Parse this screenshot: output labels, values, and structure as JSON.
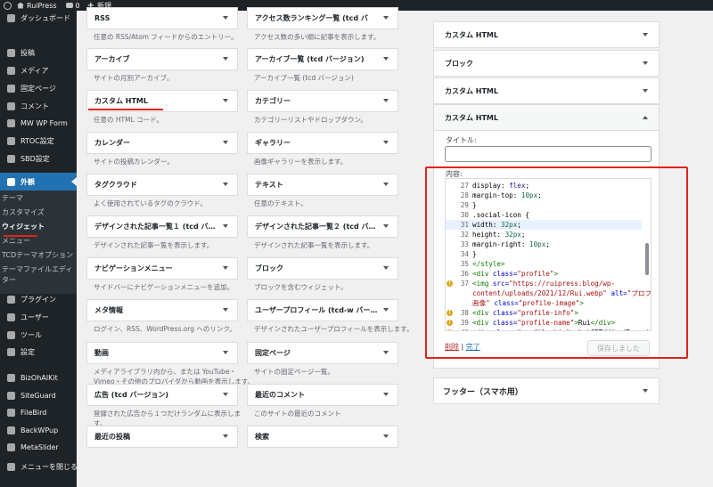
{
  "admin_bar": {
    "site_name": "RuiPress",
    "comments_count": "0",
    "new_label": "新規"
  },
  "sidebar": {
    "items": [
      {
        "label": "ダッシュボード",
        "icon": "dashboard-icon"
      },
      {
        "label": "投稿",
        "icon": "pin-icon"
      },
      {
        "label": "メディア",
        "icon": "media-icon"
      },
      {
        "label": "固定ページ",
        "icon": "page-icon"
      },
      {
        "label": "コメント",
        "icon": "comment-icon"
      },
      {
        "label": "MW WP Form",
        "icon": "form-icon"
      },
      {
        "label": "RTOC設定",
        "icon": "list-icon"
      },
      {
        "label": "SBD設定",
        "icon": "gear-icon"
      },
      {
        "label": "外観",
        "icon": "brush-icon"
      },
      {
        "label": "プラグイン",
        "icon": "plugin-icon"
      },
      {
        "label": "ユーザー",
        "icon": "user-icon"
      },
      {
        "label": "ツール",
        "icon": "wrench-icon"
      },
      {
        "label": "設定",
        "icon": "settings-icon"
      },
      {
        "label": "BizOhAIKit",
        "icon": "kit-icon"
      },
      {
        "label": "SiteGuard",
        "icon": "shield-icon"
      },
      {
        "label": "FileBird",
        "icon": "folder-icon"
      },
      {
        "label": "BackWPup",
        "icon": "backup-icon"
      },
      {
        "label": "MetaSlider",
        "icon": "slider-icon"
      },
      {
        "label": "メニューを閉じる",
        "icon": "collapse-icon"
      }
    ],
    "submenu": [
      "テーマ",
      "カスタマイズ",
      "ウィジェット",
      "メニュー",
      "TCDテーマオプション",
      "テーマファイルエディ",
      "ター"
    ]
  },
  "widgets": [
    {
      "title": "RSS",
      "desc": "任意の RSS/Atom フィードからのエントリー。"
    },
    {
      "title": "アクセス数ランキング一覧 (tcd バ",
      "desc": "アクセス数の多い順に記事を表示します。"
    },
    {
      "title": "アーカイブ",
      "desc": "サイトの月別アーカイブ。"
    },
    {
      "title": "アーカイブ一覧 (tcd バージョン)",
      "desc": "アーカイブ一覧 (tcd バージョン)"
    },
    {
      "title": "カスタム HTML",
      "desc": "任意の HTML コード。"
    },
    {
      "title": "カテゴリー",
      "desc": "カテゴリーリストやドロップダウン。"
    },
    {
      "title": "カレンダー",
      "desc": "サイトの投稿カレンダー。"
    },
    {
      "title": "ギャラリー",
      "desc": "画像ギャラリーを表示します。"
    },
    {
      "title": "タグクラウド",
      "desc": "よく使用されているタグのクラウド。"
    },
    {
      "title": "テキスト",
      "desc": "任意のテキスト。"
    },
    {
      "title": "デザインされた記事一覧１ (tcd バ…",
      "desc": "デザインされた記事一覧を表示します。"
    },
    {
      "title": "デザインされた記事一覧２ (tcd バ…",
      "desc": "デザインされた記事一覧を表示します。"
    },
    {
      "title": "ナビゲーションメニュー",
      "desc": "サイドバーにナビゲーションメニューを追加。"
    },
    {
      "title": "ブロック",
      "desc": "ブロックを含むウィジェット。"
    },
    {
      "title": "メタ情報",
      "desc": "ログイン、RSS、WordPress.org へのリンク。"
    },
    {
      "title": "ユーザープロフィール (tcd-w バー…",
      "desc": "デザインされたユーザープロフィールを表示します。"
    },
    {
      "title": "動画",
      "desc": "メディアライブラリ内から、または YouTube・",
      "desc2": "Vimeo・その他のプロバイダから動画を表示します。"
    },
    {
      "title": "固定ページ",
      "desc": "サイトの固定ページ一覧。"
    },
    {
      "title": "広告 (tcd バージョン)",
      "desc": "登録された広告から１つだけランダムに表示しま",
      "desc2": "す。"
    },
    {
      "title": "最近のコメント",
      "desc": "このサイトの最近のコメント"
    },
    {
      "title": "最近の投稿",
      "desc": ""
    },
    {
      "title": "検索",
      "desc": ""
    }
  ],
  "widget_area": {
    "items": [
      "カスタム HTML",
      "ブロック",
      "カスタム HTML",
      "カスタム HTML"
    ],
    "title_label": "タイトル:",
    "content_label": "内容:",
    "delete_link": "削除",
    "separator": " | ",
    "done_link": "完了",
    "save_button": "保存しました",
    "footer_area": "フッター（スマホ用）"
  },
  "code_lines": [
    {
      "n": "27",
      "parts": [
        [
          "",
          "    display: "
        ],
        [
          "kw",
          "flex"
        ],
        [
          "",
          ";"
        ]
      ]
    },
    {
      "n": "28",
      "parts": [
        [
          "",
          "    margin-top: "
        ],
        [
          "num",
          "10px"
        ],
        [
          "",
          ";"
        ]
      ]
    },
    {
      "n": "29",
      "parts": [
        [
          "",
          "  }"
        ]
      ]
    },
    {
      "n": "30",
      "parts": [
        [
          "",
          "  .social-icon {"
        ]
      ]
    },
    {
      "n": "31",
      "parts": [
        [
          "",
          "    width: "
        ],
        [
          "num",
          "32px"
        ],
        [
          "",
          ";"
        ]
      ],
      "hl": true
    },
    {
      "n": "32",
      "parts": [
        [
          "",
          "    height: "
        ],
        [
          "num",
          "32px"
        ],
        [
          "",
          ";"
        ]
      ]
    },
    {
      "n": "33",
      "parts": [
        [
          "",
          "    margin-right: "
        ],
        [
          "num",
          "10px"
        ],
        [
          "",
          ";"
        ]
      ]
    },
    {
      "n": "34",
      "parts": [
        [
          "",
          "  }"
        ]
      ]
    },
    {
      "n": "35",
      "parts": [
        [
          "tag",
          "</style>"
        ]
      ]
    },
    {
      "n": "36",
      "parts": [
        [
          "tag",
          "<div "
        ],
        [
          "attr",
          "class="
        ],
        [
          "str",
          "\"profile\""
        ],
        [
          "tag",
          ">"
        ]
      ]
    },
    {
      "n": "37",
      "warn": true,
      "parts": [
        [
          "tag",
          "  <img "
        ],
        [
          "attr",
          "src="
        ],
        [
          "str",
          "\"https://ruipress.blog/wp-"
        ]
      ]
    },
    {
      "n": "",
      "parts": [
        [
          "str",
          "content/uploads/2021/12/Rui.webp\""
        ],
        [
          "",
          " "
        ],
        [
          "attr",
          "alt="
        ],
        [
          "str",
          "\"プロフィール"
        ]
      ]
    },
    {
      "n": "",
      "parts": [
        [
          "str",
          "画像\""
        ],
        [
          "",
          " "
        ],
        [
          "attr",
          "class="
        ],
        [
          "str",
          "\"profile-image\""
        ],
        [
          "tag",
          ">"
        ]
      ]
    },
    {
      "n": "38",
      "warn": true,
      "parts": [
        [
          "tag",
          "  <div "
        ],
        [
          "attr",
          "class="
        ],
        [
          "str",
          "\"profile-info\""
        ],
        [
          "tag",
          ">"
        ]
      ]
    },
    {
      "n": "39",
      "warn": true,
      "parts": [
        [
          "tag",
          "    <div "
        ],
        [
          "attr",
          "class="
        ],
        [
          "str",
          "\"profile-name\""
        ],
        [
          "tag",
          ">"
        ],
        [
          "",
          "Rui"
        ],
        [
          "tag",
          "</div>"
        ]
      ]
    },
    {
      "n": "40",
      "warn": true,
      "parts": [
        [
          "tag",
          "    <div "
        ],
        [
          "attr",
          "class="
        ],
        [
          "str",
          "\"profile-bio\""
        ],
        [
          "tag",
          ">"
        ],
        [
          "",
          "chatGPTをWordPressに搭載"
        ]
      ]
    }
  ]
}
